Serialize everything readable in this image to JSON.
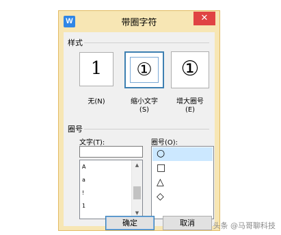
{
  "dialog": {
    "title": "带圈字符",
    "app_icon_letter": "W",
    "close_glyph": "✕"
  },
  "style": {
    "section_label": "样式",
    "options": [
      {
        "glyph": "1",
        "label": "无(N)",
        "selected": false
      },
      {
        "glyph": "①",
        "label_line1": "缩小文字",
        "label_line2": "(S)",
        "selected": true
      },
      {
        "glyph": "①",
        "label_line1": "增大圈号",
        "label_line2": "(E)",
        "selected": false
      }
    ]
  },
  "circle": {
    "section_label": "圈号",
    "text_label": "文字(T):",
    "enclosure_label": "圈号(O):",
    "text_value": "",
    "char_list": [
      "A",
      "a",
      "!",
      "1"
    ],
    "enclosures": [
      {
        "name": "circle",
        "glyph": "○",
        "selected": true
      },
      {
        "name": "square",
        "glyph": "□",
        "selected": false
      },
      {
        "name": "triangle",
        "glyph": "△",
        "selected": false
      },
      {
        "name": "diamond",
        "glyph": "◇",
        "selected": false
      }
    ]
  },
  "buttons": {
    "ok": "确定",
    "cancel": "取消"
  },
  "watermark": "头条 @马哥聊科技",
  "colors": {
    "frame": "#f7e6b4",
    "close": "#e04343",
    "selection": "#cce8ff",
    "accent_border": "#3c7fb1"
  }
}
